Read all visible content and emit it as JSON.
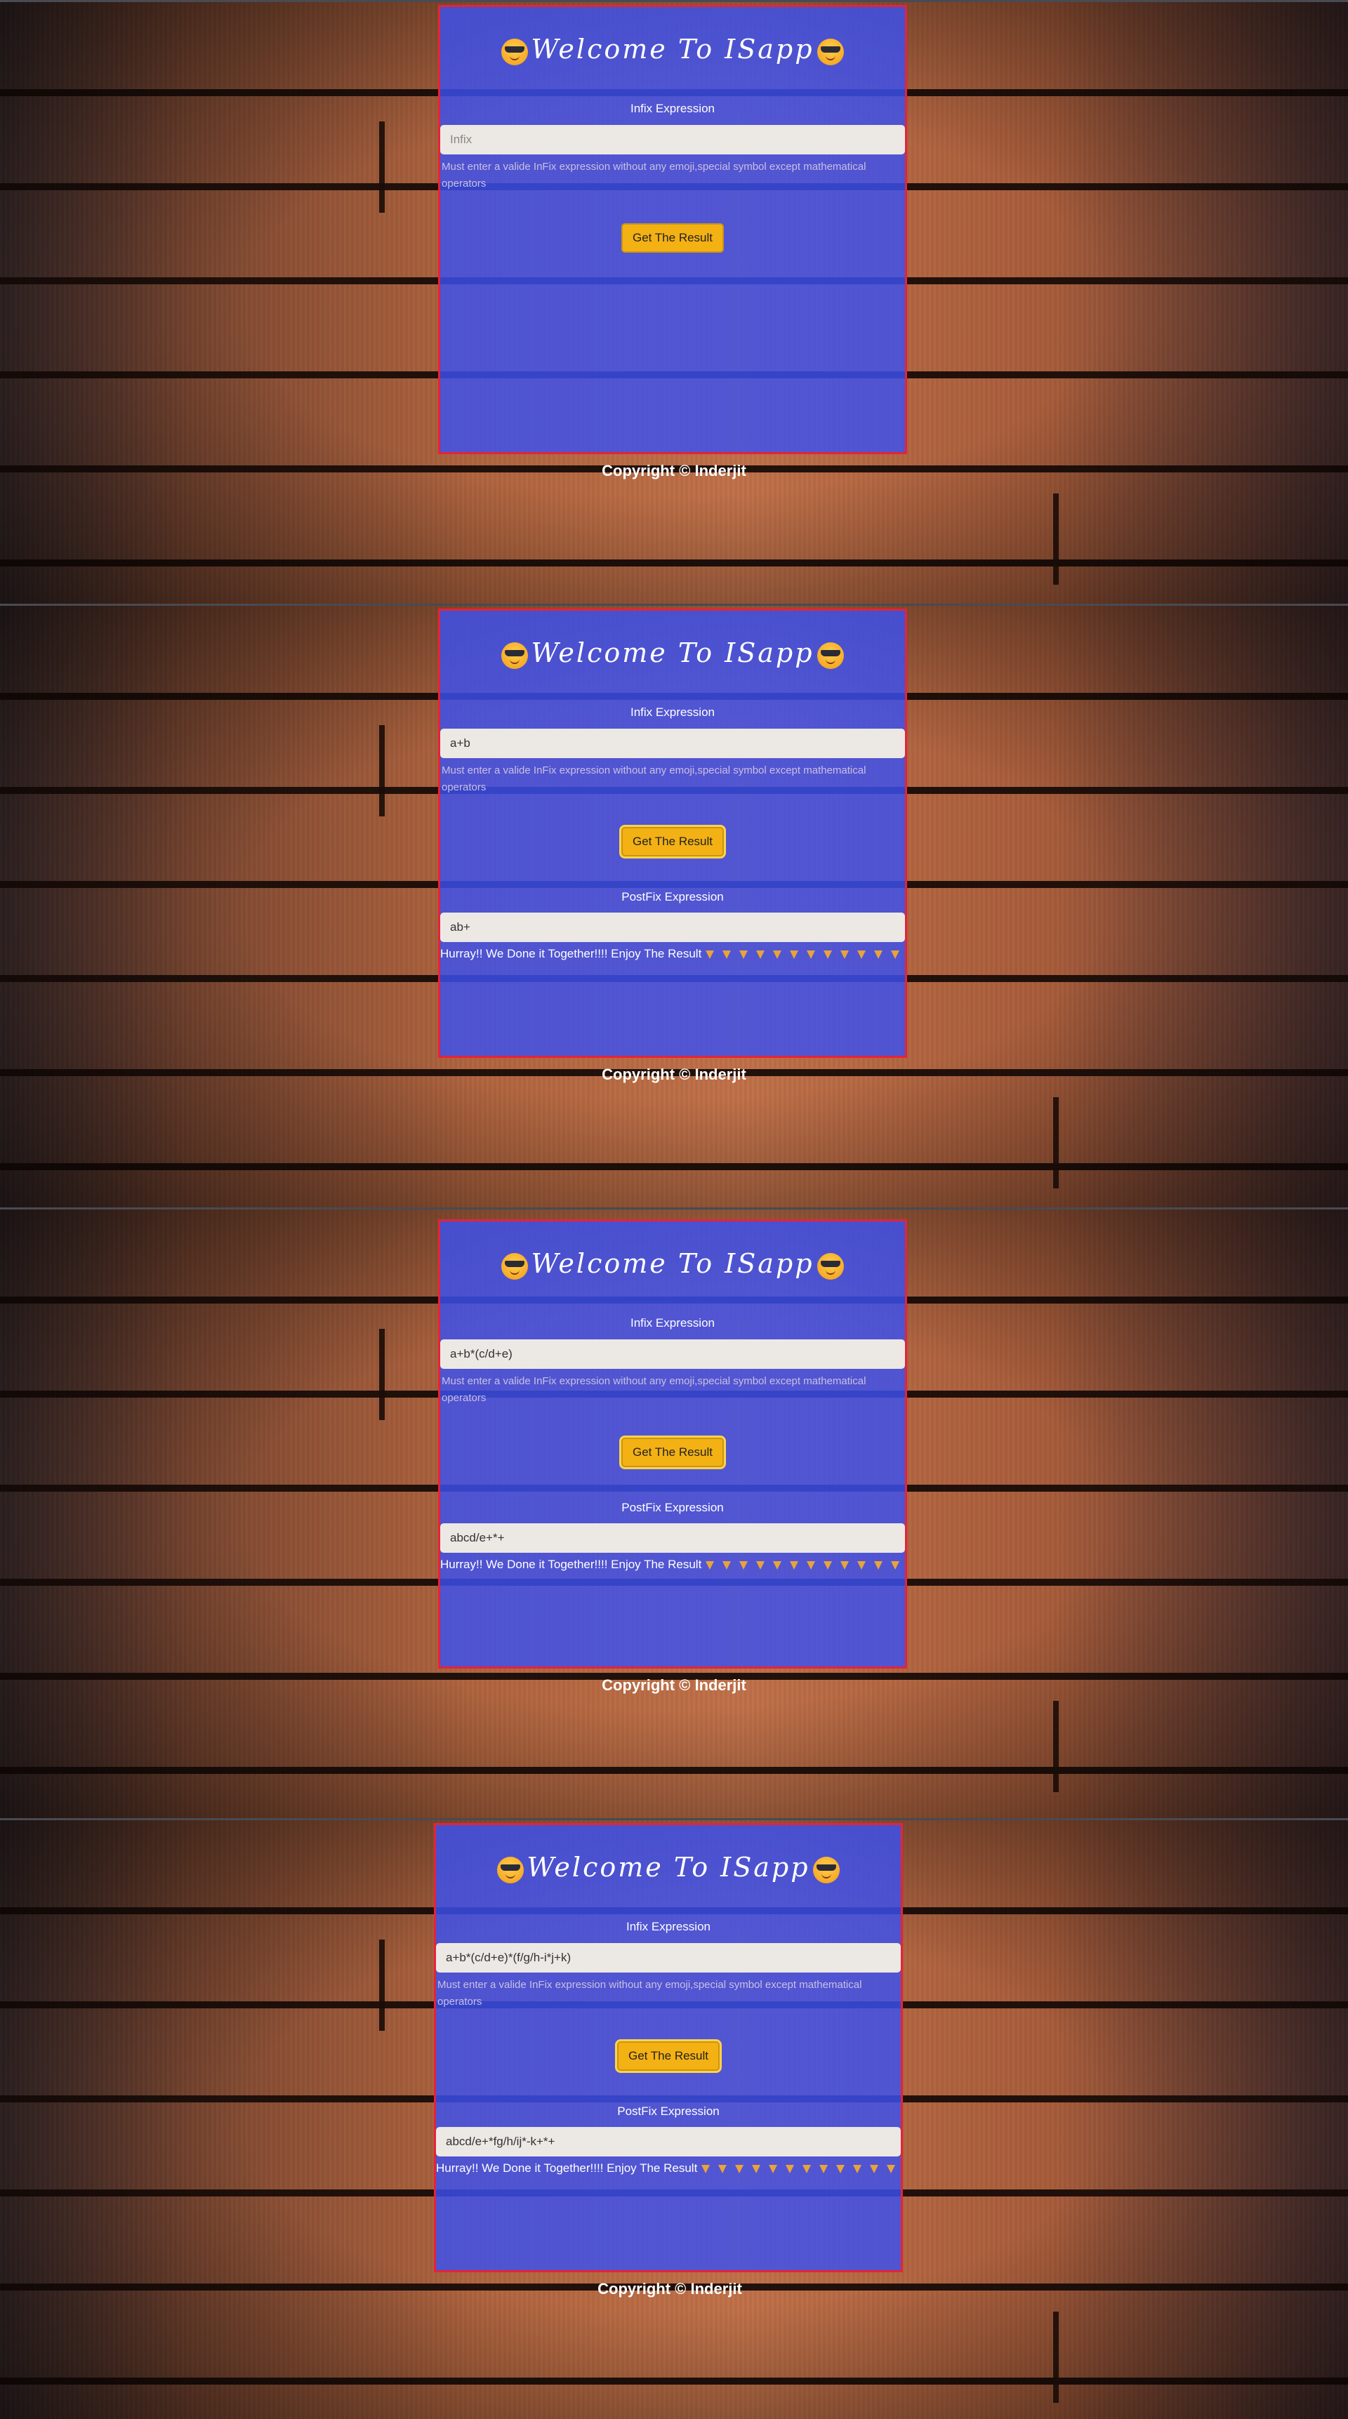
{
  "app": {
    "title": "Welcome To ISapp",
    "infix_label": "Infix Expression",
    "infix_placeholder": "Infix",
    "help_text": "Must enter a valide InFix expression without any emoji,special symbol except mathematical operators",
    "button_label": "Get The Result",
    "postfix_label": "PostFix Expression",
    "hurray_text": "Hurray!! We Done it Together!!!! Enjoy The Result",
    "copyright": "Copyright © Inderjit",
    "emoji_icon": "sunglasses-face-icon",
    "pizza_icon": "pizza-slice-icon"
  },
  "colors": {
    "card_bg": "#3a50f0",
    "card_border": "#e4233a",
    "button_bg": "#f3b114",
    "field_bg": "#ece8e4"
  },
  "screens": [
    {
      "infix_value": "",
      "postfix_value": ""
    },
    {
      "infix_value": "a+b",
      "postfix_value": "ab+"
    },
    {
      "infix_value": "a+b*(c/d+e)",
      "postfix_value": "abcd/e+*+"
    },
    {
      "infix_value": "a+b*(c/d+e)*(f/g/h-i*j+k)",
      "postfix_value": "abcd/e+*fg/h/ij*-k+*+"
    }
  ]
}
